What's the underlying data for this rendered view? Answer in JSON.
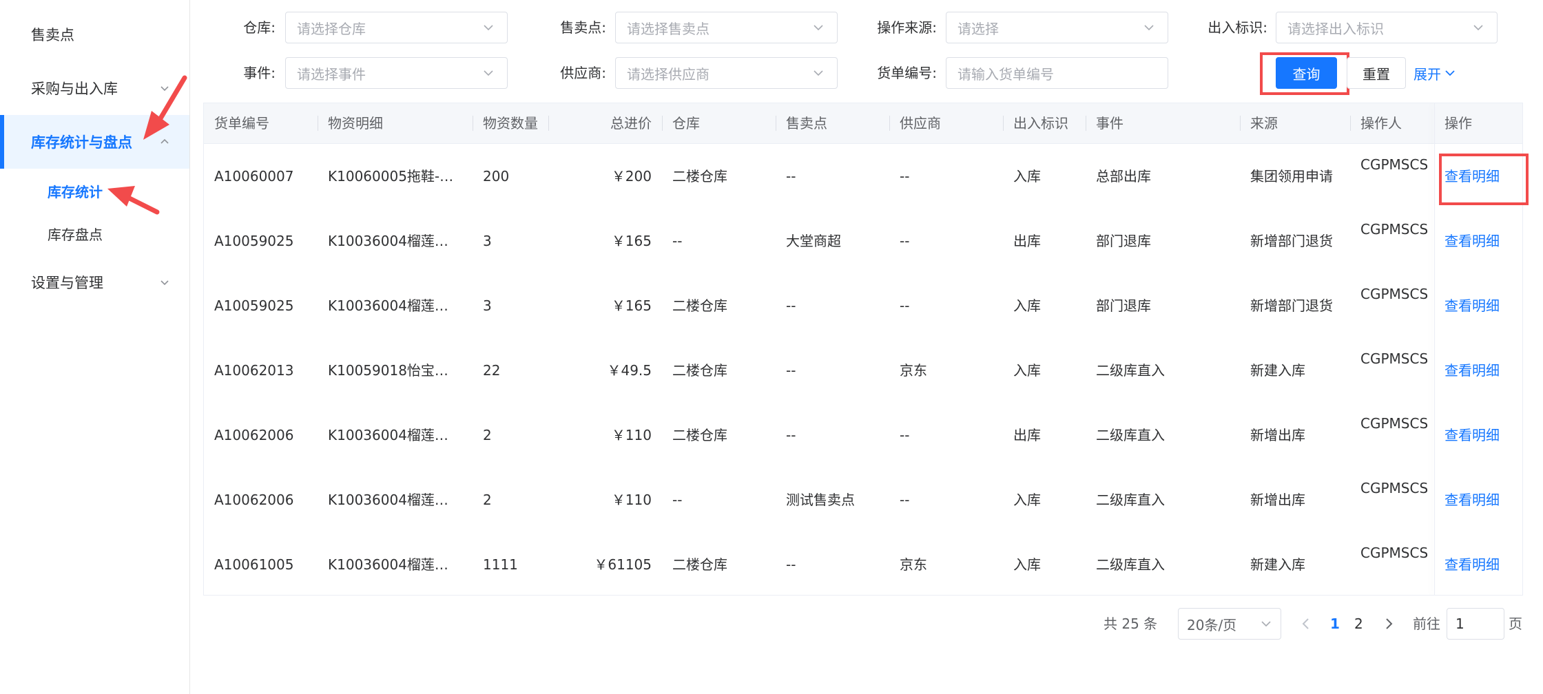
{
  "sidebar": {
    "items": [
      {
        "label": "售卖点"
      },
      {
        "label": "采购与出入库"
      },
      {
        "label": "库存统计与盘点"
      },
      {
        "label": "设置与管理"
      }
    ],
    "sub_items": [
      {
        "label": "库存统计"
      },
      {
        "label": "库存盘点"
      }
    ]
  },
  "filters": {
    "warehouse": {
      "label": "仓库:",
      "placeholder": "请选择仓库"
    },
    "sale_point": {
      "label": "售卖点:",
      "placeholder": "请选择售卖点"
    },
    "op_source": {
      "label": "操作来源:",
      "placeholder": "请选择"
    },
    "io_flag": {
      "label": "出入标识:",
      "placeholder": "请选择出入标识"
    },
    "event": {
      "label": "事件:",
      "placeholder": "请选择事件"
    },
    "supplier": {
      "label": "供应商:",
      "placeholder": "请选择供应商"
    },
    "doc_no": {
      "label": "货单编号:",
      "placeholder": "请输入货单编号"
    },
    "query_label": "查询",
    "reset_label": "重置",
    "expand_label": "展开"
  },
  "table": {
    "headers": [
      "货单编号",
      "物资明细",
      "物资数量",
      "总进价",
      "仓库",
      "售卖点",
      "供应商",
      "出入标识",
      "事件",
      "来源",
      "操作人",
      "操作"
    ],
    "rows": [
      {
        "doc": "A10060007",
        "detail": "K10060005拖鞋-…",
        "qty": "200",
        "price": "￥200",
        "warehouse": "二楼仓库",
        "sale_point": "--",
        "supplier": "--",
        "io": "入库",
        "event": "总部出库",
        "source": "集团领用申请",
        "operator": "CGPMSCS",
        "action": "查看明细"
      },
      {
        "doc": "A10059025",
        "detail": "K10036004榴莲…",
        "qty": "3",
        "price": "￥165",
        "warehouse": "--",
        "sale_point": "大堂商超",
        "supplier": "--",
        "io": "出库",
        "event": "部门退库",
        "source": "新增部门退货",
        "operator": "CGPMSCS",
        "action": "查看明细"
      },
      {
        "doc": "A10059025",
        "detail": "K10036004榴莲…",
        "qty": "3",
        "price": "￥165",
        "warehouse": "二楼仓库",
        "sale_point": "--",
        "supplier": "--",
        "io": "入库",
        "event": "部门退库",
        "source": "新增部门退货",
        "operator": "CGPMSCS",
        "action": "查看明细"
      },
      {
        "doc": "A10062013",
        "detail": "K10059018怡宝…",
        "qty": "22",
        "price": "￥49.5",
        "warehouse": "二楼仓库",
        "sale_point": "--",
        "supplier": "京东",
        "io": "入库",
        "event": "二级库直入",
        "source": "新建入库",
        "operator": "CGPMSCS",
        "action": "查看明细"
      },
      {
        "doc": "A10062006",
        "detail": "K10036004榴莲…",
        "qty": "2",
        "price": "￥110",
        "warehouse": "二楼仓库",
        "sale_point": "--",
        "supplier": "--",
        "io": "出库",
        "event": "二级库直入",
        "source": "新增出库",
        "operator": "CGPMSCS",
        "action": "查看明细"
      },
      {
        "doc": "A10062006",
        "detail": "K10036004榴莲…",
        "qty": "2",
        "price": "￥110",
        "warehouse": "--",
        "sale_point": "测试售卖点",
        "supplier": "--",
        "io": "入库",
        "event": "二级库直入",
        "source": "新增出库",
        "operator": "CGPMSCS",
        "action": "查看明细"
      },
      {
        "doc": "A10061005",
        "detail": "K10036004榴莲…",
        "qty": "1111",
        "price": "￥61105",
        "warehouse": "二楼仓库",
        "sale_point": "--",
        "supplier": "京东",
        "io": "入库",
        "event": "二级库直入",
        "source": "新建入库",
        "operator": "CGPMSCS",
        "action": "查看明细"
      }
    ]
  },
  "pagination": {
    "total": "共 25 条",
    "page_size": "20条/页",
    "pages": [
      "1",
      "2"
    ],
    "goto_label": "前往",
    "goto_value": "1",
    "goto_suffix": "页"
  },
  "colors": {
    "accent": "#1677ff",
    "annotation": "#f24b4b",
    "header_bg": "#f5f7fa"
  }
}
